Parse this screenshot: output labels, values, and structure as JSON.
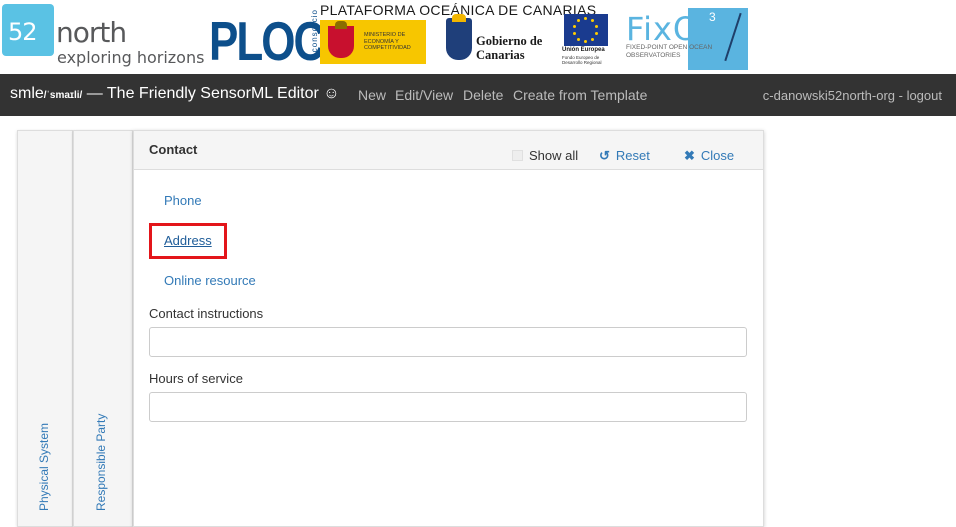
{
  "logos": {
    "north52_number": "52",
    "north52_word": "north",
    "north52_tagline": "exploring horizons",
    "plocan": "PLOCAN",
    "plocan_consorcio": "consorcio",
    "plataforma": "PLATAFORMA OCEÁNICA DE CANARIAS",
    "ministerio": "MINISTERIO DE ECONOMÍA Y COMPETITIVIDAD",
    "gobierno": "Gobierno de Canarias",
    "eu_name": "Unión Europea",
    "eu_fund": "Fondo Europeo de Desarrollo Regional",
    "fixo_word": "FixO",
    "fixo_sup": "3",
    "fixo_sub": "FIXED-POINT OPEN OCEAN OBSERVATORIES"
  },
  "navbar": {
    "brand_name": "smle",
    "brand_phonetic": "/ˈsmaɪli/",
    "brand_rest": " — The Friendly SensorML Editor ☺",
    "links": [
      "New",
      "Edit/View",
      "Delete",
      "Create from Template"
    ],
    "user": "c-danowski52north-org - logout"
  },
  "tabs": {
    "physical": "Physical System",
    "responsible": "Responsible Party"
  },
  "panel": {
    "title": "Contact",
    "show_all": "Show all",
    "reset": "Reset",
    "close": "Close",
    "links": {
      "phone": "Phone",
      "address": "Address",
      "online": "Online resource"
    },
    "fields": {
      "instructions_label": "Contact instructions",
      "instructions_value": "",
      "hours_label": "Hours of service",
      "hours_value": ""
    }
  },
  "colors": {
    "navbar_bg": "#333333",
    "link": "#337ab7",
    "highlight": "#e3151a"
  }
}
